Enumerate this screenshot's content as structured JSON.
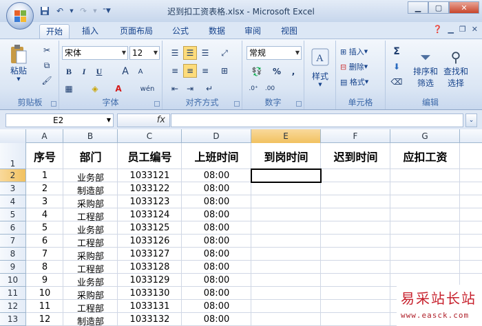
{
  "window": {
    "title": "迟到扣工资表格.xlsx - Microsoft Excel"
  },
  "qat": {
    "icons": [
      "save-icon",
      "undo-icon",
      "redo-icon",
      "customize-icon"
    ]
  },
  "tabs": [
    {
      "label": "开始",
      "active": true
    },
    {
      "label": "插入",
      "active": false
    },
    {
      "label": "页面布局",
      "active": false
    },
    {
      "label": "公式",
      "active": false
    },
    {
      "label": "数据",
      "active": false
    },
    {
      "label": "审阅",
      "active": false
    },
    {
      "label": "视图",
      "active": false
    }
  ],
  "ribbon": {
    "clipboard": {
      "label": "剪贴板",
      "paste": "粘贴"
    },
    "font": {
      "label": "字体",
      "name": "宋体",
      "size": "12",
      "bold": "B",
      "italic": "I",
      "underline": "U",
      "grow": "A",
      "shrink": "A",
      "wen": "wén"
    },
    "alignment": {
      "label": "对齐方式"
    },
    "number": {
      "label": "数字",
      "format": "常规",
      "percent": "%",
      "comma": ","
    },
    "styles": {
      "label": "样式"
    },
    "cells": {
      "label": "单元格",
      "insert": "插入",
      "delete": "删除",
      "format": "格式"
    },
    "editing": {
      "label": "编辑",
      "sort": "排序和",
      "sort2": "筛选",
      "find": "查找和",
      "find2": "选择",
      "sum": "Σ"
    }
  },
  "formula_bar": {
    "name_box": "E2",
    "fx": "fx",
    "value": ""
  },
  "sheet": {
    "columns": [
      "A",
      "B",
      "C",
      "D",
      "E",
      "F",
      "G"
    ],
    "selected_column": "E",
    "selected_row": "2",
    "header_row": [
      "序号",
      "部门",
      "员工编号",
      "上班时间",
      "到岗时间",
      "迟到时间",
      "应扣工资"
    ],
    "rows": [
      {
        "no": "1",
        "dept": "业务部",
        "id": "1033121",
        "time": "08:00"
      },
      {
        "no": "2",
        "dept": "制造部",
        "id": "1033122",
        "time": "08:00"
      },
      {
        "no": "3",
        "dept": "采购部",
        "id": "1033123",
        "time": "08:00"
      },
      {
        "no": "4",
        "dept": "工程部",
        "id": "1033124",
        "time": "08:00"
      },
      {
        "no": "5",
        "dept": "业务部",
        "id": "1033125",
        "time": "08:00"
      },
      {
        "no": "6",
        "dept": "工程部",
        "id": "1033126",
        "time": "08:00"
      },
      {
        "no": "7",
        "dept": "采购部",
        "id": "1033127",
        "time": "08:00"
      },
      {
        "no": "8",
        "dept": "工程部",
        "id": "1033128",
        "time": "08:00"
      },
      {
        "no": "9",
        "dept": "业务部",
        "id": "1033129",
        "time": "08:00"
      },
      {
        "no": "10",
        "dept": "采购部",
        "id": "1033130",
        "time": "08:00"
      },
      {
        "no": "11",
        "dept": "工程部",
        "id": "1033131",
        "time": "08:00"
      },
      {
        "no": "12",
        "dept": "制造部",
        "id": "1033132",
        "time": "08:00"
      }
    ],
    "row_numbers": [
      "1",
      "2",
      "3",
      "4",
      "5",
      "6",
      "7",
      "8",
      "9",
      "10",
      "11",
      "12",
      "13"
    ]
  },
  "watermark": {
    "line1": "易采站长站",
    "line2": "www.easck.com"
  }
}
